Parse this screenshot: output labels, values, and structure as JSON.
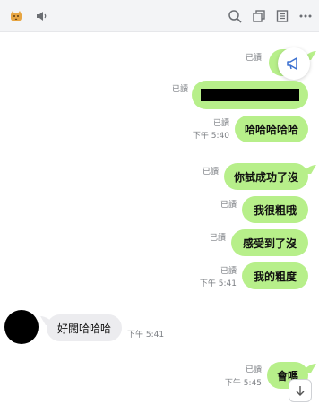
{
  "header": {
    "icons": [
      "dog-avatar-icon",
      "speaker-icon",
      "search-icon",
      "copy-icon",
      "notes-icon",
      "more-icon"
    ]
  },
  "messages": [
    {
      "dir": "out",
      "text": "",
      "read": "已讀",
      "time": ""
    },
    {
      "dir": "out",
      "text": "",
      "read": "已讀",
      "time": "",
      "redacted": true
    },
    {
      "dir": "out",
      "text": "哈哈哈哈哈",
      "read": "已讀",
      "time": "下午 5:40"
    },
    {
      "dir": "out",
      "text": "你試成功了沒",
      "read": "已讀",
      "time": ""
    },
    {
      "dir": "out",
      "text": "我很粗哦",
      "read": "已讀",
      "time": ""
    },
    {
      "dir": "out",
      "text": "感受到了沒",
      "read": "已讀",
      "time": ""
    },
    {
      "dir": "out",
      "text": "我的粗度",
      "read": "已讀",
      "time": "下午 5:41"
    },
    {
      "dir": "in",
      "text": "好闊哈哈哈",
      "read": "",
      "time": "下午 5:41"
    },
    {
      "dir": "out",
      "text": "會嗎",
      "read": "已讀",
      "time": "下午 5:45"
    }
  ],
  "floating": {
    "announce_icon": "megaphone-icon",
    "scroll_icon": "arrow-down-icon"
  },
  "colors": {
    "out_bubble": "#b7ef8a",
    "in_bubble": "#ececef",
    "header_bg": "#f3f4f6"
  }
}
